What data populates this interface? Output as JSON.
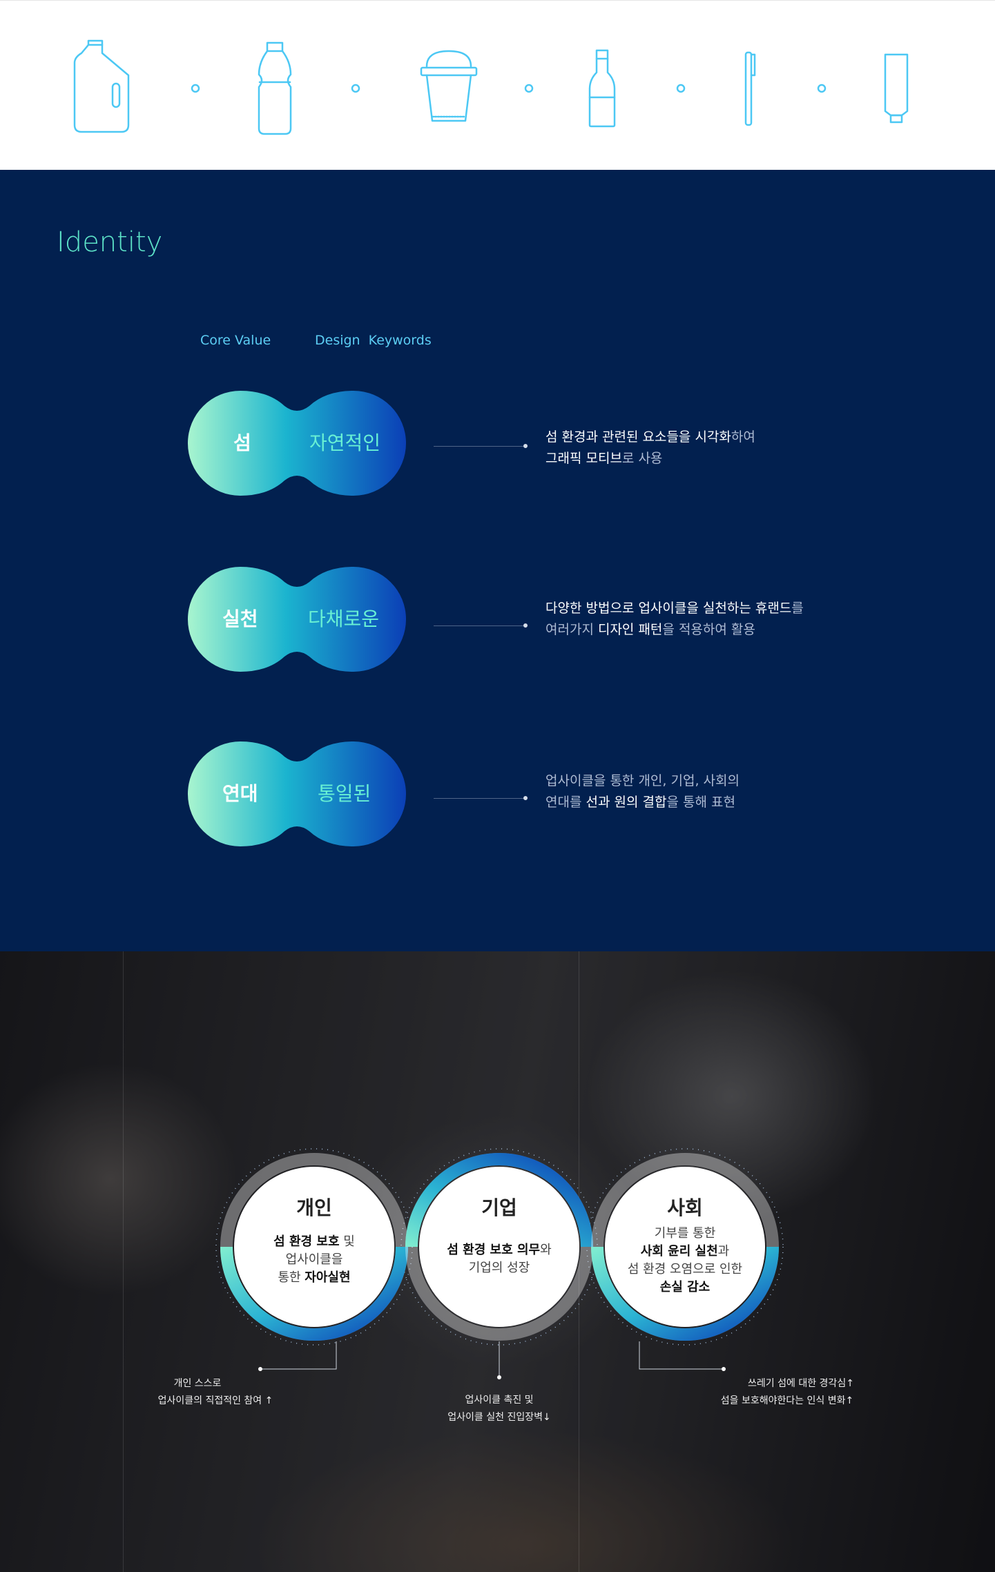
{
  "icons": [
    "detergent-bottle-icon",
    "water-bottle-icon",
    "cup-icon",
    "glass-bottle-icon",
    "toothbrush-icon",
    "tube-icon"
  ],
  "identity": {
    "title": "Identity",
    "headers": {
      "core": "Core Value",
      "keywords": "Design  Keywords"
    },
    "rows": [
      {
        "value": "섬",
        "keyword": "자연적인",
        "desc1": "섬 환경과 관련된 요소들을 시각화",
        "desc1b": "하여",
        "desc2": "그래픽 모티브",
        "desc2b": "로 사용"
      },
      {
        "value": "실천",
        "keyword": "다채로운",
        "desc1": "다양한 방법으로 업사이클을 실천하는 휴랜드",
        "desc1b": "를",
        "desc2a": "여러가지 ",
        "desc2": "디자인 패턴",
        "desc2b": "을 적용하여 활용"
      },
      {
        "value": "연대",
        "keyword": "통일된",
        "desc1": "업사이클을 통한 개인, 기업, 사회의",
        "desc2a": "연대를 ",
        "desc2": "선과 원의 결합",
        "desc2b": "을 통해 표현"
      }
    ]
  },
  "circles": [
    {
      "title": "개인",
      "l1a": "섬 환경 보호",
      "l1b": " 및",
      "l2": "업사이클을",
      "l3a": "통한 ",
      "l3b": "자아실현"
    },
    {
      "title": "기업",
      "l1a": "섬 환경 보호 의무",
      "l1b": "와",
      "l2": "기업의 성장"
    },
    {
      "title": "사회",
      "l1": "기부를 통한",
      "l2a": "사회 윤리 실천",
      "l2b": "과",
      "l3": "섬 환경 오염으로 인한",
      "l4": "손실 감소"
    }
  ],
  "notes": [
    {
      "l1": "개인 스스로",
      "l2": "업사이클의 직접적인 참여 ↑"
    },
    {
      "l1": "업사이클 촉진 및",
      "l2": "업사이클 실천 진입장벽↓"
    },
    {
      "l1": "쓰레기 섬에 대한 경각심↑",
      "l2": "섬을 보호해야한다는 인식 변화↑"
    }
  ],
  "colors": {
    "navy": "#02204f",
    "mint": "#5de3c8",
    "sky": "#5ccdf3",
    "blue": "#0b3fb6",
    "icon": "#4cc8f4"
  }
}
